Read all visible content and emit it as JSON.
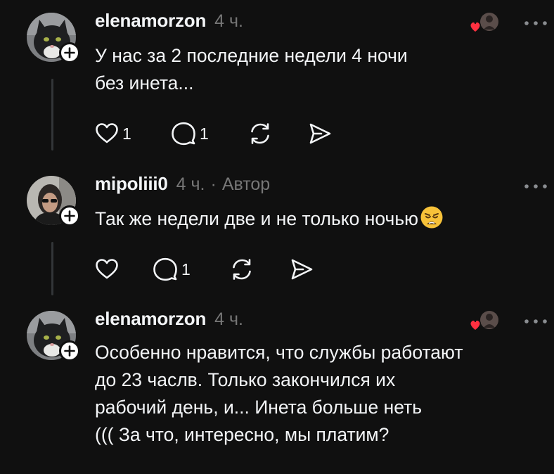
{
  "comments": [
    {
      "username": "elenamorzon",
      "time": "4 ч.",
      "lines": [
        "У нас за 2 последние недели 4 ночи",
        "без инета..."
      ],
      "likes": "1",
      "replies": "1",
      "liked_by_author": true,
      "avatar_icon": "cat-avatar-icon"
    },
    {
      "username": "mipoliii0",
      "time": "4 ч.",
      "separator": "·",
      "badge": "Автор",
      "lines": [
        "Так же недели две и не только ночью"
      ],
      "emoji": "weary-face-emoji",
      "likes": "",
      "replies": "1",
      "liked_by_author": false,
      "avatar_icon": "person-avatar-icon"
    },
    {
      "username": "elenamorzon",
      "time": "4 ч.",
      "lines": [
        "Особенно нравится, что службы работают",
        "до 23 часлв. Только закончился их",
        "рабочий день, и... Инета больше неть",
        "((( За что, интересно, мы платим?"
      ],
      "liked_by_author": true,
      "avatar_icon": "cat-avatar-icon"
    }
  ],
  "colors": {
    "background": "#101010",
    "text": "#f3f5f7",
    "muted": "#777777",
    "like_heart": "#ff3040",
    "thread_line": "#333638"
  }
}
